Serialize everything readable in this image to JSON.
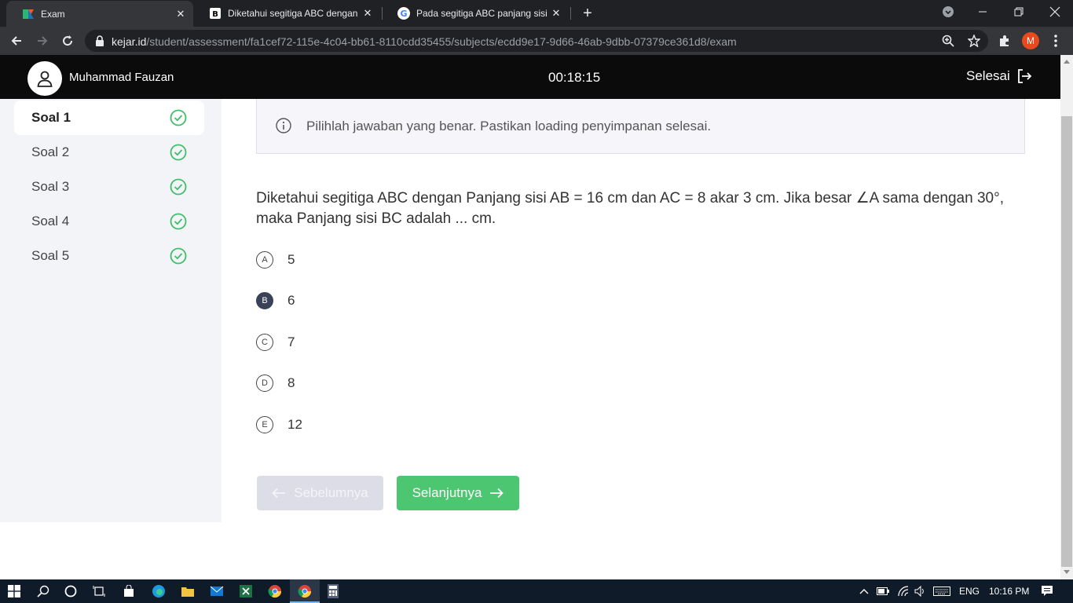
{
  "browser": {
    "tabs": [
      {
        "title": "Exam",
        "active": true
      },
      {
        "title": "Diketahui segitiga ABC dengan p",
        "active": false
      },
      {
        "title": "Pada segitiga ABC panjang sisi a",
        "active": false
      }
    ],
    "url_host": "kejar.id",
    "url_path": "/student/assessment/fa1cef72-115e-4c04-bb61-8110cdd35455/subjects/ecdd9e17-9d66-46ab-9dbb-07379ce361d8/exam",
    "profile_initial": "M"
  },
  "header": {
    "user_name": "Muhammad Fauzan",
    "timer": "00:18:15",
    "finish_label": "Selesai"
  },
  "sidebar": {
    "items": [
      {
        "label": "Soal 1",
        "done": true,
        "active": true
      },
      {
        "label": "Soal 2",
        "done": true,
        "active": false
      },
      {
        "label": "Soal 3",
        "done": true,
        "active": false
      },
      {
        "label": "Soal 4",
        "done": true,
        "active": false
      },
      {
        "label": "Soal 5",
        "done": true,
        "active": false
      }
    ]
  },
  "main": {
    "info": "Pilihlah jawaban yang benar. Pastikan loading penyimpanan selesai.",
    "question": "Diketahui segitiga ABC dengan Panjang sisi AB = 16 cm dan AC = 8 akar 3 cm. Jika besar ∠A sama dengan 30°, maka Panjang sisi BC adalah ... cm.",
    "options": [
      {
        "letter": "A",
        "value": "5",
        "selected": false
      },
      {
        "letter": "B",
        "value": "6",
        "selected": true
      },
      {
        "letter": "C",
        "value": "7",
        "selected": false
      },
      {
        "letter": "D",
        "value": "8",
        "selected": false
      },
      {
        "letter": "E",
        "value": "12",
        "selected": false
      }
    ],
    "prev_label": "Sebelumnya",
    "next_label": "Selanjutnya"
  },
  "taskbar": {
    "language": "ENG",
    "time": "10:16 PM"
  },
  "colors": {
    "success": "#4dc672",
    "selected_option": "#3a4257",
    "header_bg": "#0b0b0b"
  }
}
